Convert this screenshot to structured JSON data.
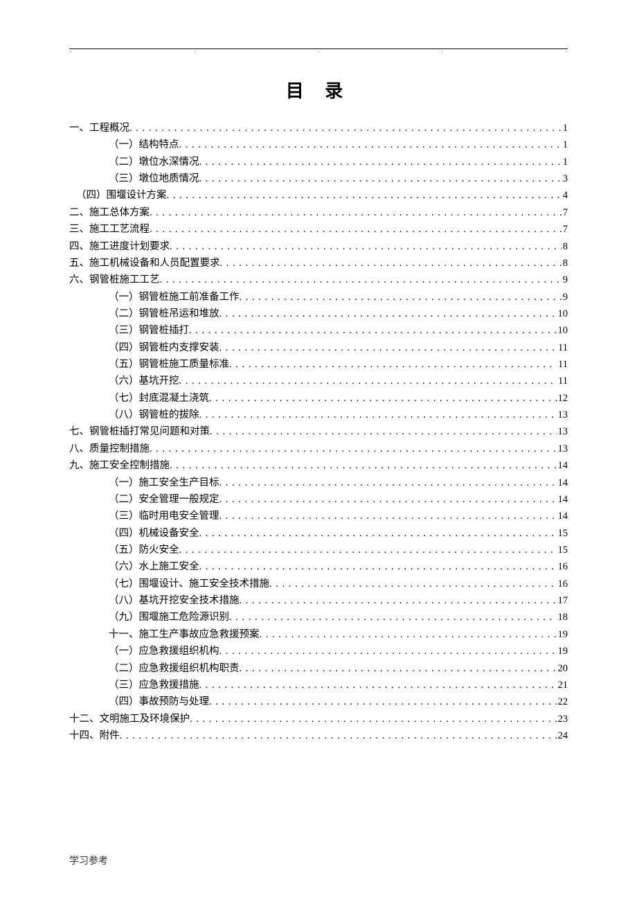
{
  "title": "目 录",
  "footer": "学习参考",
  "toc": [
    {
      "level": "level-1",
      "label": "一、工程概况",
      "page": "1"
    },
    {
      "level": "level-2",
      "label": "（一）结构特点",
      "page": "1"
    },
    {
      "level": "level-2",
      "label": "（二）墩位水深情况",
      "page": "1"
    },
    {
      "level": "level-2",
      "label": "（三）墩位地质情况",
      "page": "3"
    },
    {
      "level": "level-1b",
      "label": "（四）围堰设计方案",
      "page": "4"
    },
    {
      "level": "level-1",
      "label": "二、施工总体方案",
      "page": "7"
    },
    {
      "level": "level-1",
      "label": "三、施工工艺流程",
      "page": "7"
    },
    {
      "level": "level-1",
      "label": "四、施工进度计划要求",
      "page": "8"
    },
    {
      "level": "level-1",
      "label": "五、施工机械设备和人员配置要求",
      "page": "8"
    },
    {
      "level": "level-1",
      "label": "六、钢管桩施工工艺",
      "page": "9"
    },
    {
      "level": "level-2",
      "label": "（一）钢管桩施工前准备工作",
      "page": "9"
    },
    {
      "level": "level-2",
      "label": "（二）钢管桩吊运和堆放",
      "page": "10"
    },
    {
      "level": "level-2",
      "label": "（三）钢管桩插打",
      "page": "10"
    },
    {
      "level": "level-2",
      "label": "（四）钢管桩内支撑安装",
      "page": "11"
    },
    {
      "level": "level-2",
      "label": "（五）钢管桩施工质量标准",
      "page": "11"
    },
    {
      "level": "level-2",
      "label": "（六）基坑开挖",
      "page": "11"
    },
    {
      "level": "level-2",
      "label": "（七）封底混凝土浇筑",
      "page": "12"
    },
    {
      "level": "level-2",
      "label": "（八）钢管桩的拔除",
      "page": "13"
    },
    {
      "level": "level-1",
      "label": "七、钢管桩插打常见问题和对策",
      "page": "13"
    },
    {
      "level": "level-1",
      "label": "八、质量控制措施",
      "page": "13"
    },
    {
      "level": "level-1",
      "label": "九、施工安全控制措施",
      "page": "14"
    },
    {
      "level": "level-2",
      "label": "（一）施工安全生产目标",
      "page": "14"
    },
    {
      "level": "level-2",
      "label": "（二）安全管理一般规定",
      "page": "14"
    },
    {
      "level": "level-2",
      "label": "（三）临时用电安全管理",
      "page": "14"
    },
    {
      "level": "level-2",
      "label": "（四）机械设备安全",
      "page": "15"
    },
    {
      "level": "level-2",
      "label": "（五）防火安全",
      "page": "15"
    },
    {
      "level": "level-2",
      "label": "（六）水上施工安全",
      "page": "16"
    },
    {
      "level": "level-2",
      "label": "（七）围堰设计、施工安全技术措施",
      "page": "16"
    },
    {
      "level": "level-2",
      "label": "（八）基坑开挖安全技术措施",
      "page": "17"
    },
    {
      "level": "level-2",
      "label": "（九）围堰施工危险源识别",
      "page": "18"
    },
    {
      "level": "level-2",
      "label": "十一、施工生产事故应急救援预案",
      "page": "19"
    },
    {
      "level": "level-2",
      "label": "（一）应急救援组织机构",
      "page": "19"
    },
    {
      "level": "level-2",
      "label": "（二）应急救援组织机构职责",
      "page": "20"
    },
    {
      "level": "level-2",
      "label": "（三）应急救援措施",
      "page": "21"
    },
    {
      "level": "level-2",
      "label": "（四）事故预防与处理",
      "page": "22"
    },
    {
      "level": "level-1",
      "label": "十二、文明施工及环境保护",
      "page": "23"
    },
    {
      "level": "level-1",
      "label": "十四、附件",
      "page": "24"
    }
  ]
}
